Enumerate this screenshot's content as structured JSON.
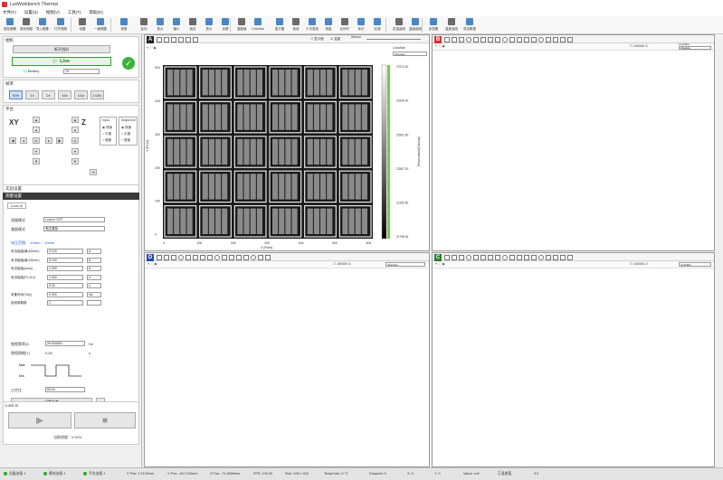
{
  "window": {
    "title": "LuxWorkbench Thermal"
  },
  "menu": [
    "文件(F)",
    "设置(S)",
    "视图(V)",
    "工具(T)",
    "帮助(H)"
  ],
  "ribbon": [
    {
      "label": "保存图像",
      "x": 2
    },
    {
      "label": "保存视频",
      "x": 20
    },
    {
      "label": "导入图像",
      "x": 38
    },
    {
      "label": "打开视频",
      "x": 58
    },
    {
      "label": "设置",
      "x": 82
    },
    {
      "label": "一键调整",
      "x": 102
    },
    {
      "label": "参数",
      "x": 128
    },
    {
      "label": "反向",
      "x": 150
    },
    {
      "label": "放大",
      "x": 168
    },
    {
      "label": "缩小",
      "x": 186
    },
    {
      "label": "适应",
      "x": 204
    },
    {
      "label": "放大",
      "x": 222
    },
    {
      "label": "全屏",
      "x": 240
    },
    {
      "label": "温度轴",
      "x": 258
    },
    {
      "label": "ColorBar",
      "x": 276
    },
    {
      "label": "直方图",
      "x": 300
    },
    {
      "label": "剖线",
      "x": 318
    },
    {
      "label": "十字准线",
      "x": 336
    },
    {
      "label": "测量",
      "x": 354
    },
    {
      "label": "比例尺",
      "x": 372
    },
    {
      "label": "标记",
      "x": 390
    },
    {
      "label": "区域",
      "x": 408
    },
    {
      "label": "定温曲线",
      "x": 432
    },
    {
      "label": "温度曲线",
      "x": 450
    },
    {
      "label": "多视图",
      "x": 470
    },
    {
      "label": "温差曲线",
      "x": 490
    },
    {
      "label": "导出数据",
      "x": 510
    }
  ],
  "left": {
    "camera_section": "相机",
    "connect_btn": "断开相机",
    "live_label": "Live",
    "battery_label": "Battery",
    "battery_value": "78",
    "speed_section": "帧率",
    "speed_buttons": [
      "60fr",
      "1x",
      "2x",
      "16x",
      "1/4x",
      "1/16x"
    ],
    "stage_section": "平台",
    "xy_label": "XY",
    "z_label": "Z",
    "step_section": "Input",
    "step_options": [
      "快速",
      "中速",
      "慢速"
    ],
    "control_section": "Sequence",
    "control_options": [
      "快速",
      "中速",
      "慢速"
    ],
    "measure_section": "实验设置",
    "tab_header": "测量设置",
    "tab_lockin": "Lock-In",
    "fields": [
      {
        "label": "测量模式",
        "value": "Lock-in SOT"
      },
      {
        "label": "激励模式",
        "value": "电压激励"
      }
    ],
    "link_text": "电压范围：-10mm ~ 10mm",
    "param_rows": [
      {
        "label": "电流幅值(最大Bmm)",
        "value": "0.100",
        "unit": "A"
      },
      {
        "label": "电流幅值(最小Bmm)",
        "value": "0.100",
        "unit": "A"
      },
      {
        "label": "电流幅值(Iamp)",
        "value": "1.000",
        "unit": "A"
      },
      {
        "label": "电流幅值(PV-DU)",
        "value": "1.000",
        "unit": "V"
      },
      {
        "label": "",
        "value": "0.00",
        "unit": "s"
      },
      {
        "label": "采集时间(Tdly)",
        "value": "0.000",
        "unit": "ms"
      },
      {
        "label": "锁相周期数",
        "value": "1",
        "unit": ""
      }
    ],
    "freq_label": "锁相频率(f)",
    "freq_value": "25.000000",
    "freq_unit": "Hz",
    "period_label": "锁相周期(T)",
    "period_value": "0.00",
    "period_unit": "s",
    "wave_max": "Max",
    "wave_min": "Min",
    "duty_label": "占空比",
    "duty_value": "50.00",
    "apply_btn": "设置参数",
    "hint_text": "开始Lock-in测量",
    "lockin_section": "Lock-in",
    "progress_label": "当前进度：0.00%"
  },
  "panels": {
    "A": {
      "letter": "A",
      "color": "#222222"
    },
    "B": {
      "letter": "B",
      "color": "#d9302c"
    },
    "D": {
      "letter": "D",
      "color": "#2a4aa8"
    },
    "C": {
      "letter": "C",
      "color": "#2e7d32"
    }
  },
  "panelA": {
    "checkbox1": "显示值",
    "checkbox2": "温度",
    "sensor_label": "Sensor",
    "palette_label": "ColorBar",
    "palette_value": "Absolute",
    "y_axis_label": "Y [Pixel]",
    "x_axis_label": "X [Pixel]",
    "colorbar_label": "Temperature[Celsius]",
    "x_ticks": [
      "0",
      "100",
      "200",
      "300",
      "400",
      "500",
      "600"
    ],
    "y_ticks": [
      "500",
      "400",
      "300",
      "200",
      "100",
      "0"
    ],
    "cb_ticks": [
      "23721.00",
      "23336.40",
      "22951.80",
      "22567.20",
      "22182.60",
      "21798.00"
    ]
  },
  "panelB": {
    "zoom": "100000",
    "palette_label": "ColorBar",
    "palette_value": "Absolute"
  },
  "panelD": {
    "zoom": "100000",
    "palette_label": "Absolute"
  },
  "panelC": {
    "zoom": "100000",
    "palette_label": "ColorBar"
  },
  "status": [
    {
      "text": "设备连接 1",
      "x": 4,
      "dot": true
    },
    {
      "text": "模块连接 1",
      "x": 48,
      "dot": true
    },
    {
      "text": "平台连接 1",
      "x": 92,
      "dot": true
    },
    {
      "text": "X Pos: 2.2100mm",
      "x": 140,
      "dot": false
    },
    {
      "text": "Y Pos: -18.7140mm",
      "x": 185,
      "dot": false
    },
    {
      "text": "Z Pos: -71.6599mm",
      "x": 232,
      "dot": false
    },
    {
      "text": "FPS: 100.00",
      "x": 280,
      "dot": false
    },
    {
      "text": "Size: 640 x 512",
      "x": 315,
      "dot": false
    },
    {
      "text": "TempCam: 0 °C",
      "x": 358,
      "dot": false
    },
    {
      "text": "Dropped: 0",
      "x": 408,
      "dot": false
    },
    {
      "text": "X: 0",
      "x": 450,
      "dot": false
    },
    {
      "text": "Y: 0",
      "x": 480,
      "dot": false
    },
    {
      "text": "Value: null",
      "x": 512,
      "dot": false
    },
    {
      "text": "正温差值",
      "x": 550,
      "dot": false
    },
    {
      "text": "0.0",
      "x": 590,
      "dot": false
    }
  ]
}
